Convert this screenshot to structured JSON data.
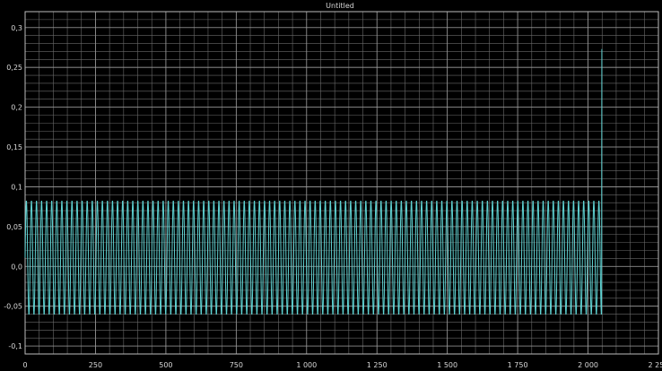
{
  "chart_data": {
    "type": "line",
    "title": "Untitled",
    "xlabel": "",
    "ylabel": "",
    "xlim": [
      0,
      2250
    ],
    "ylim": [
      -0.11,
      0.32
    ],
    "x_ticks": [
      0,
      250,
      500,
      750,
      1000,
      1250,
      1500,
      1750,
      2000,
      2250
    ],
    "x_tick_labels": [
      "0",
      "250",
      "500",
      "750",
      "1 000",
      "1 250",
      "1 500",
      "1 750",
      "2 000",
      "2 250"
    ],
    "y_ticks": [
      -0.1,
      -0.05,
      0.0,
      0.05,
      0.1,
      0.15,
      0.2,
      0.25,
      0.3
    ],
    "y_tick_labels": [
      "-0,1",
      "-0,05",
      "0,0",
      "0,05",
      "0,1",
      "0,15",
      "0,2",
      "0,25",
      "0,3"
    ],
    "grid": true,
    "minor_grid": true,
    "colors": {
      "background": "#000000",
      "grid": "#6a6a6a",
      "axis_text": "#d8d8d8",
      "series": "#5fd3d3"
    },
    "series": [
      {
        "name": "",
        "description_of_shape": "oscillation",
        "period": 18,
        "amplitude_max": 0.083,
        "amplitude_min": -0.061,
        "x_start": 0,
        "x_end": 2048,
        "final_spike": {
          "x": 2049,
          "y": 0.273
        }
      }
    ]
  }
}
